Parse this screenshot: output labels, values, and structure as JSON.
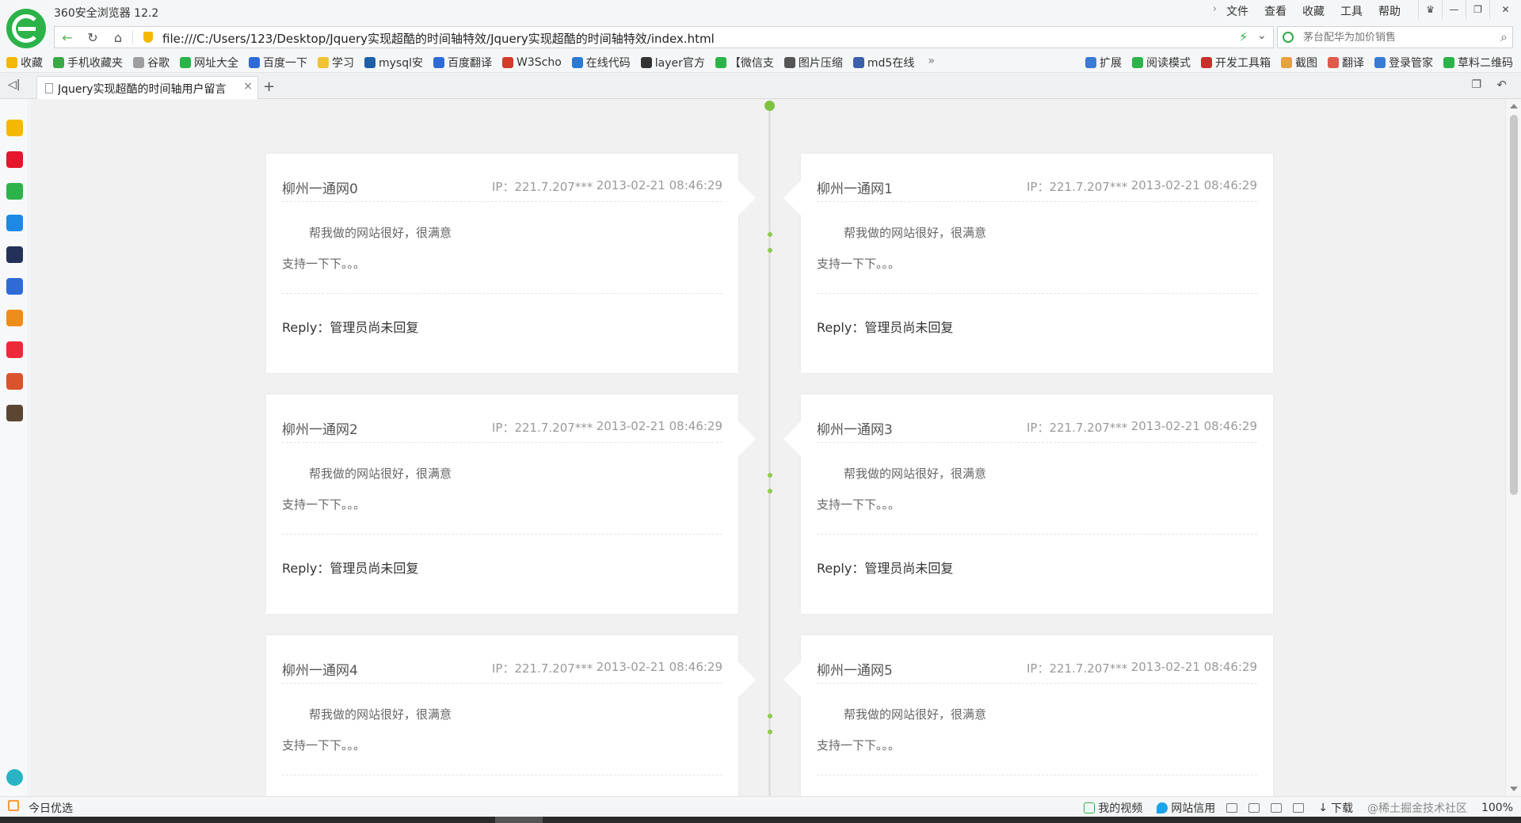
{
  "app": {
    "title": "360安全浏览器 12.2",
    "menu": [
      "文件",
      "查看",
      "收藏",
      "工具",
      "帮助"
    ]
  },
  "address": {
    "url": "file:///C:/Users/123/Desktop/Jquery实现超酷的时间轴特效/Jquery实现超酷的时间轴特效/index.html",
    "search_placeholder": "茅台配华为加价销售"
  },
  "bookmarks": {
    "left": [
      {
        "label": "收藏",
        "icon": "star-icon",
        "color": "#f5b800"
      },
      {
        "label": "手机收藏夹",
        "icon": "phone-icon",
        "color": "#3aa845"
      },
      {
        "label": "谷歌",
        "icon": "page-icon",
        "color": "#9e9e9e"
      },
      {
        "label": "网址大全",
        "icon": "globe-icon",
        "color": "#2bb34a"
      },
      {
        "label": "百度一下",
        "icon": "paw-icon",
        "color": "#2f6bd6"
      },
      {
        "label": "学习",
        "icon": "folder-icon",
        "color": "#f1c232"
      },
      {
        "label": "mysql安",
        "icon": "dolphin-icon",
        "color": "#1e5fa8"
      },
      {
        "label": "百度翻译",
        "icon": "paw-icon",
        "color": "#2f6bd6"
      },
      {
        "label": "W3Scho",
        "icon": "w3-icon",
        "color": "#d33b2b"
      },
      {
        "label": "在线代码",
        "icon": "code-icon",
        "color": "#2a7ad3"
      },
      {
        "label": "layer官方",
        "icon": "layer-icon",
        "color": "#333333"
      },
      {
        "label": "【微信支",
        "icon": "wechat-icon",
        "color": "#2db34a"
      },
      {
        "label": "图片压缩",
        "icon": "image-icon",
        "color": "#555555"
      },
      {
        "label": "md5在线",
        "icon": "md5-icon",
        "color": "#3b5fa8"
      }
    ],
    "more": "»",
    "right": [
      {
        "label": "扩展",
        "icon": "puzzle-icon",
        "color": "#3a7bd5"
      },
      {
        "label": "阅读模式",
        "icon": "reader-icon",
        "color": "#2db34a"
      },
      {
        "label": "开发工具箱",
        "icon": "js-icon",
        "color": "#c9302c"
      },
      {
        "label": "截图",
        "icon": "scissors-icon",
        "color": "#e6a23c"
      },
      {
        "label": "翻译",
        "icon": "translate-icon",
        "color": "#e05a4b"
      },
      {
        "label": "登录管家",
        "icon": "key-icon",
        "color": "#3a7bd5"
      },
      {
        "label": "草料二维码",
        "icon": "qrcode-icon",
        "color": "#2db34a"
      }
    ]
  },
  "tab": {
    "title": "Jquery实现超酷的时间轴用户留言",
    "close": "×",
    "new": "+"
  },
  "sidebar": [
    {
      "icon": "star-icon",
      "color": "#f5b800"
    },
    {
      "icon": "weibo-icon",
      "color": "#e6162d"
    },
    {
      "icon": "mail-icon",
      "color": "#2db34a"
    },
    {
      "icon": "p-app-icon",
      "color": "#1e88e5"
    },
    {
      "icon": "news-app-icon",
      "color": "#23315a"
    },
    {
      "icon": "doc-app-icon",
      "color": "#2f6bd6"
    },
    {
      "icon": "novel-app-icon",
      "color": "#f08c1a"
    },
    {
      "icon": "shop-app-icon",
      "color": "#ee2a3a"
    },
    {
      "icon": "game-app-icon",
      "color": "#d9532c"
    },
    {
      "icon": "game2-app-icon",
      "color": "#5a4632"
    }
  ],
  "messages": [
    {
      "name": "柳州一通网0",
      "ip": "IP：221.7.207***",
      "time": "2013-02-21 08:46:29",
      "line1": "帮我做的网站很好，很满意",
      "line2": "支持一下下。。。",
      "reply": "Reply：管理员尚未回复"
    },
    {
      "name": "柳州一通网1",
      "ip": "IP：221.7.207***",
      "time": "2013-02-21 08:46:29",
      "line1": "帮我做的网站很好，很满意",
      "line2": "支持一下下。。。",
      "reply": "Reply：管理员尚未回复"
    },
    {
      "name": "柳州一通网2",
      "ip": "IP：221.7.207***",
      "time": "2013-02-21 08:46:29",
      "line1": "帮我做的网站很好，很满意",
      "line2": "支持一下下。。。",
      "reply": "Reply：管理员尚未回复"
    },
    {
      "name": "柳州一通网3",
      "ip": "IP：221.7.207***",
      "time": "2013-02-21 08:46:29",
      "line1": "帮我做的网站很好，很满意",
      "line2": "支持一下下。。。",
      "reply": "Reply：管理员尚未回复"
    },
    {
      "name": "柳州一通网4",
      "ip": "IP：221.7.207***",
      "time": "2013-02-21 08:46:29",
      "line1": "帮我做的网站很好，很满意",
      "line2": "支持一下下。。。",
      "reply": ""
    },
    {
      "name": "柳州一通网5",
      "ip": "IP：221.7.207***",
      "time": "2013-02-21 08:46:29",
      "line1": "帮我做的网站很好，很满意",
      "line2": "支持一下下。。。",
      "reply": ""
    }
  ],
  "status": {
    "today": "今日优选",
    "items": [
      "我的视频",
      "网站信用",
      "下载"
    ],
    "watermark": "@稀土掘金技术社区",
    "zoom": "100%"
  },
  "colors": {
    "accent": "#2db34a",
    "timeline_dot": "#8fca50",
    "content_bg": "#f1f1f1"
  }
}
